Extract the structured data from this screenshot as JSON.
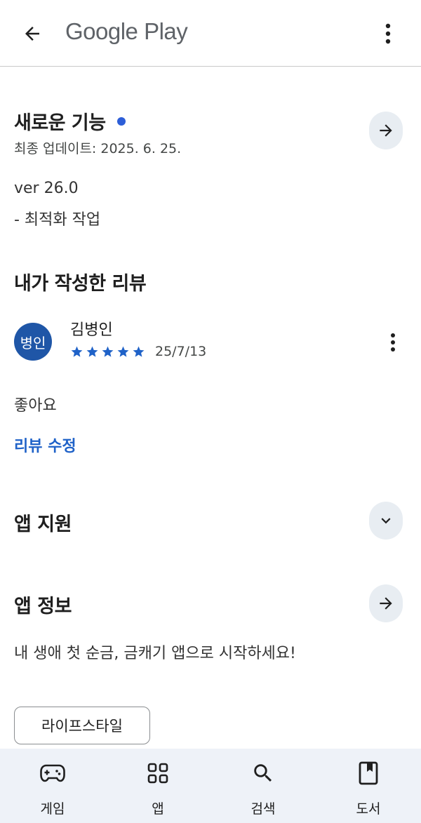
{
  "appbar": {
    "title": "Google Play"
  },
  "whats_new": {
    "heading": "새로운 기능",
    "updated": "최종 업데이트: 2025. 6. 25.",
    "version": "ver 26.0",
    "note": "- 최적화 작업"
  },
  "my_review": {
    "heading": "내가 작성한 리뷰",
    "avatar_text": "병인",
    "reviewer": "김병인",
    "rating": 5,
    "date": "25/7/13",
    "text": "좋아요",
    "edit_label": "리뷰 수정"
  },
  "app_support": {
    "heading": "앱 지원"
  },
  "app_info": {
    "heading": "앱 정보",
    "description": "내 생애 첫 순금, 금캐기 앱으로 시작하세요!",
    "category_chip": "라이프스타일"
  },
  "bottom_nav": {
    "items": [
      {
        "label": "게임",
        "icon": "gamepad-icon"
      },
      {
        "label": "앱",
        "icon": "apps-grid-icon"
      },
      {
        "label": "검색",
        "icon": "search-icon"
      },
      {
        "label": "도서",
        "icon": "book-icon"
      }
    ]
  },
  "colors": {
    "accent": "#1f62c8",
    "dot": "#2d5ed8",
    "avatar": "#1f56a7",
    "star": "#1f62c8",
    "nav_bg": "#eef2f8"
  }
}
